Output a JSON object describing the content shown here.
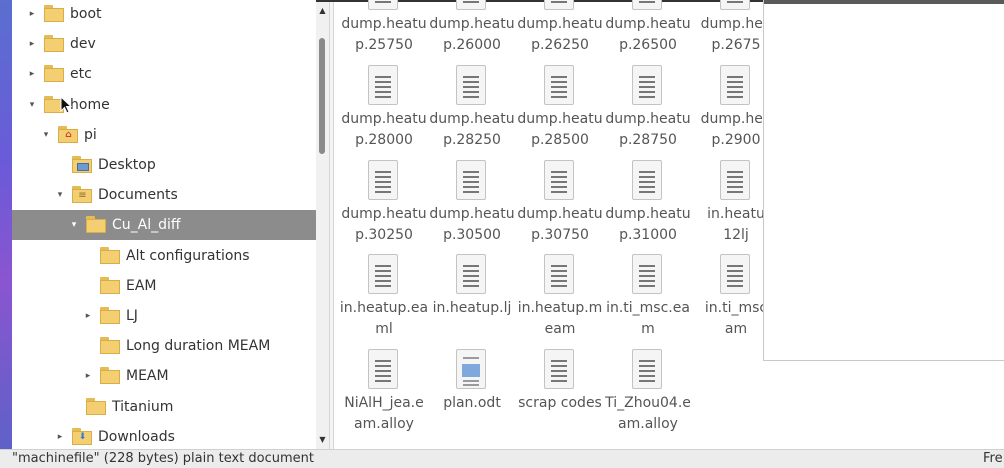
{
  "tree": {
    "items": [
      {
        "label": "boot",
        "expander": "▸",
        "emblem": ""
      },
      {
        "label": "dev",
        "expander": "▸",
        "emblem": ""
      },
      {
        "label": "etc",
        "expander": "▸",
        "emblem": ""
      },
      {
        "label": "home",
        "expander": "▾",
        "emblem": ""
      },
      {
        "label": "pi",
        "expander": "▾",
        "emblem": "home"
      },
      {
        "label": "Desktop",
        "expander": "",
        "emblem": "desktop"
      },
      {
        "label": "Documents",
        "expander": "▾",
        "emblem": "documents"
      },
      {
        "label": "Cu_Al_diff",
        "expander": "▾",
        "emblem": "",
        "selected": true
      },
      {
        "label": "Alt configurations",
        "expander": "",
        "emblem": ""
      },
      {
        "label": "EAM",
        "expander": "",
        "emblem": ""
      },
      {
        "label": "LJ",
        "expander": "▸",
        "emblem": ""
      },
      {
        "label": "Long duration MEAM",
        "expander": "",
        "emblem": ""
      },
      {
        "label": "MEAM",
        "expander": "▸",
        "emblem": ""
      },
      {
        "label": "Titanium",
        "expander": "",
        "emblem": ""
      },
      {
        "label": "Downloads",
        "expander": "▸",
        "emblem": "downloads"
      }
    ]
  },
  "files": [
    {
      "line1": "dump.heatu",
      "line2": "p.25750",
      "icon": "text-file-icon"
    },
    {
      "line1": "dump.heatu",
      "line2": "p.26000",
      "icon": "text-file-icon"
    },
    {
      "line1": "dump.heatu",
      "line2": "p.26250",
      "icon": "text-file-icon"
    },
    {
      "line1": "dump.heatu",
      "line2": "p.26500",
      "icon": "text-file-icon"
    },
    {
      "line1": "dump.hea",
      "line2": "p.2675",
      "icon": "text-file-icon"
    },
    {
      "line1": "dump.heatu",
      "line2": "p.28000",
      "icon": "text-file-icon"
    },
    {
      "line1": "dump.heatu",
      "line2": "p.28250",
      "icon": "text-file-icon"
    },
    {
      "line1": "dump.heatu",
      "line2": "p.28500",
      "icon": "text-file-icon"
    },
    {
      "line1": "dump.heatu",
      "line2": "p.28750",
      "icon": "text-file-icon"
    },
    {
      "line1": "dump.hea",
      "line2": "p.2900",
      "icon": "text-file-icon"
    },
    {
      "line1": "dump.heatu",
      "line2": "p.30250",
      "icon": "text-file-icon"
    },
    {
      "line1": "dump.heatu",
      "line2": "p.30500",
      "icon": "text-file-icon"
    },
    {
      "line1": "dump.heatu",
      "line2": "p.30750",
      "icon": "text-file-icon"
    },
    {
      "line1": "dump.heatu",
      "line2": "p.31000",
      "icon": "text-file-icon"
    },
    {
      "line1": "in.heatu",
      "line2": "12lj",
      "icon": "text-file-icon"
    },
    {
      "line1": "in.heatup.ea",
      "line2": "ml",
      "icon": "text-file-icon"
    },
    {
      "line1": "in.heatup.lj",
      "line2": "",
      "icon": "text-file-icon"
    },
    {
      "line1": "in.heatup.m",
      "line2": "eam",
      "icon": "text-file-icon"
    },
    {
      "line1": "in.ti_msc.ea",
      "line2": "m",
      "icon": "text-file-icon"
    },
    {
      "line1": "in.ti_msc",
      "line2": "am",
      "icon": "text-file-icon"
    },
    {
      "line1": "NiAlH_jea.e",
      "line2": "am.alloy",
      "icon": "text-file-icon"
    },
    {
      "line1": "plan.odt",
      "line2": "",
      "icon": "odt-document-icon"
    },
    {
      "line1": "scrap codes",
      "line2": "",
      "icon": "text-file-icon"
    },
    {
      "line1": "Ti_Zhou04.e",
      "line2": "am.alloy",
      "icon": "text-file-icon"
    }
  ],
  "status": {
    "text": "\"machinefile\" (228 bytes) plain text document",
    "free": "Fre"
  },
  "colors": {
    "selection": "#8c8c8c",
    "folder": "#f3cf71",
    "home_emblem": "#d23b2b"
  }
}
